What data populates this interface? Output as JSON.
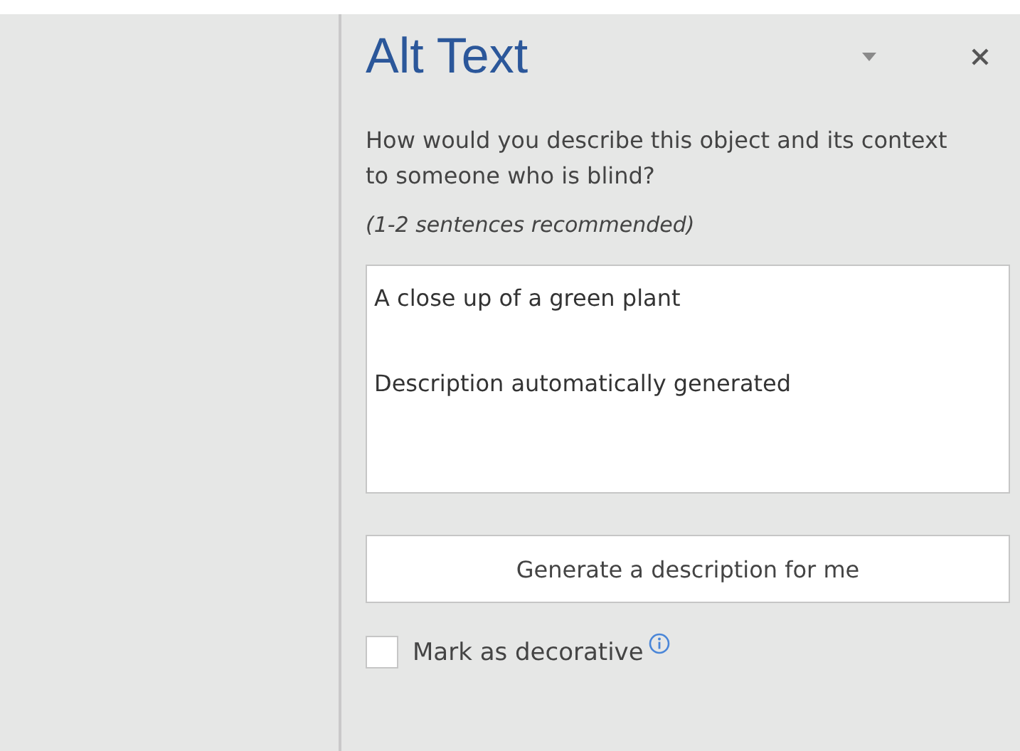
{
  "pane": {
    "title": "Alt Text",
    "prompt": "How would you describe this object and its context to someone who is blind?",
    "hint": "(1-2 sentences recommended)",
    "description": {
      "value": "A close up of a green plant\n\nDescription automatically generated"
    },
    "generate_button": "Generate a description for me",
    "decorative": {
      "label": "Mark as decorative",
      "checked": false
    }
  }
}
